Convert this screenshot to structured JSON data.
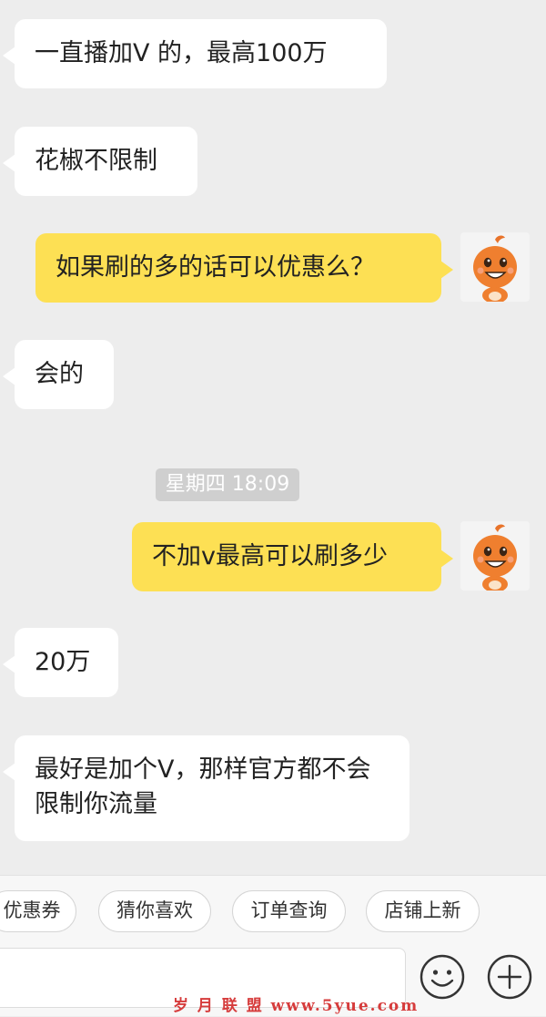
{
  "messages": [
    {
      "text": "一直播加V 的，最高100万"
    },
    {
      "text": "花椒不限制"
    },
    {
      "text": "如果刷的多的话可以优惠么？"
    },
    {
      "text": "会的"
    },
    {
      "text": "不加v最高可以刷多少"
    },
    {
      "text": "20万"
    },
    {
      "text": "最好是加个V，那样官方都不会限制你流量"
    }
  ],
  "timestamp": "星期四 18:09",
  "quick_replies": [
    "优惠券",
    "猜你喜欢",
    "订单查询",
    "店铺上新"
  ],
  "input": {
    "placeholder": ""
  },
  "icons": {
    "emoji": "smiley-icon",
    "add": "plus-icon"
  },
  "watermark": "岁 月 联 盟   www.5yue.com",
  "colors": {
    "outgoing_bubble": "#fde054",
    "incoming_bubble": "#ffffff",
    "background": "#ededed"
  }
}
